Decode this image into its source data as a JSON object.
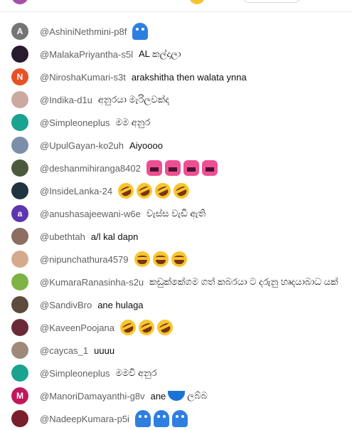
{
  "chat": {
    "messages": [
      {
        "author": "@AshiniNethmini-p8f",
        "text": "",
        "avatar": {
          "letter": "A",
          "color": "#757575"
        },
        "emojis": [
          "blue-ghost"
        ]
      },
      {
        "author": "@MalakaPriyantha-s5l",
        "text": "AL කල්දාලා",
        "avatar": {
          "letter": "",
          "color": "#2a1a2e"
        },
        "emojis": []
      },
      {
        "author": "@NiroshaKumari-s3t",
        "text": "arakshitha then walata ynna",
        "avatar": {
          "letter": "N",
          "color": "#e65125"
        },
        "emojis": []
      },
      {
        "author": "@Indika-d1u",
        "text": "අනුරයා මැරිලවක්ද",
        "avatar": {
          "letter": "",
          "color": "#c9a9a0"
        },
        "emojis": []
      },
      {
        "author": "@Simpleoneplus",
        "text": "මම අනුර",
        "avatar": {
          "letter": "",
          "color": "#1aa38f"
        },
        "emojis": []
      },
      {
        "author": "@UpulGayan-ko2uh",
        "text": "Aiyoooo",
        "avatar": {
          "letter": "",
          "color": "#7b8fa8"
        },
        "emojis": []
      },
      {
        "author": "@deshanmihiranga8402",
        "text": "",
        "avatar": {
          "letter": "",
          "color": "#4b5a3c"
        },
        "emojis": [
          "pink-monster",
          "pink-monster",
          "pink-monster",
          "pink-monster"
        ]
      },
      {
        "author": "@InsideLanka-24",
        "text": "",
        "avatar": {
          "letter": "",
          "color": "#1f3340"
        },
        "emojis": [
          "rofl",
          "rofl",
          "rofl",
          "rofl"
        ]
      },
      {
        "author": "@anushasajeewani-w6e",
        "text": "වැස්ස වැඩි ඇති",
        "avatar": {
          "letter": "a",
          "color": "#5e35b1"
        },
        "emojis": []
      },
      {
        "author": "@ubethtah",
        "text": "a/l kal dapn",
        "avatar": {
          "letter": "",
          "color": "#8d6e63"
        },
        "emojis": []
      },
      {
        "author": "@nipunchathura4579",
        "text": "",
        "avatar": {
          "letter": "",
          "color": "#d7a98c"
        },
        "emojis": [
          "laugh",
          "laugh",
          "laugh"
        ]
      },
      {
        "author": "@KumaraRanasinha-s2u",
        "text": "කඩුක්කේගම ගත් කබරයා ට දරුනු හෘදයාබාධ යක්",
        "avatar": {
          "letter": "",
          "color": "#7cb342"
        },
        "emojis": []
      },
      {
        "author": "@SandivBro",
        "text": "ane hulaga",
        "avatar": {
          "letter": "",
          "color": "#5d4b3c"
        },
        "emojis": []
      },
      {
        "author": "@KaveenPoojana",
        "text": "",
        "avatar": {
          "letter": "",
          "color": "#6a2a3a"
        },
        "emojis": [
          "rofl",
          "rofl",
          "rofl"
        ]
      },
      {
        "author": "@caycas_1",
        "text": "uuuu",
        "avatar": {
          "letter": "",
          "color": "#9e8a7a"
        },
        "emojis": []
      },
      {
        "author": "@Simpleoneplus",
        "text": "මමවි අනුර",
        "avatar": {
          "letter": "",
          "color": "#1aa38f"
        },
        "emojis": []
      },
      {
        "author": "@ManoriDamayanthi-g8v",
        "text": "ane",
        "text2": "ලබ්බ",
        "avatar": {
          "letter": "M",
          "color": "#c2185b"
        },
        "emojis": [
          "blue-bowl"
        ]
      },
      {
        "author": "@NadeepKumara-p5i",
        "text": "",
        "avatar": {
          "letter": "",
          "color": "#7a1f2a"
        },
        "emojis": [
          "blue-ghost",
          "blue-ghost",
          "blue-ghost"
        ]
      }
    ]
  }
}
